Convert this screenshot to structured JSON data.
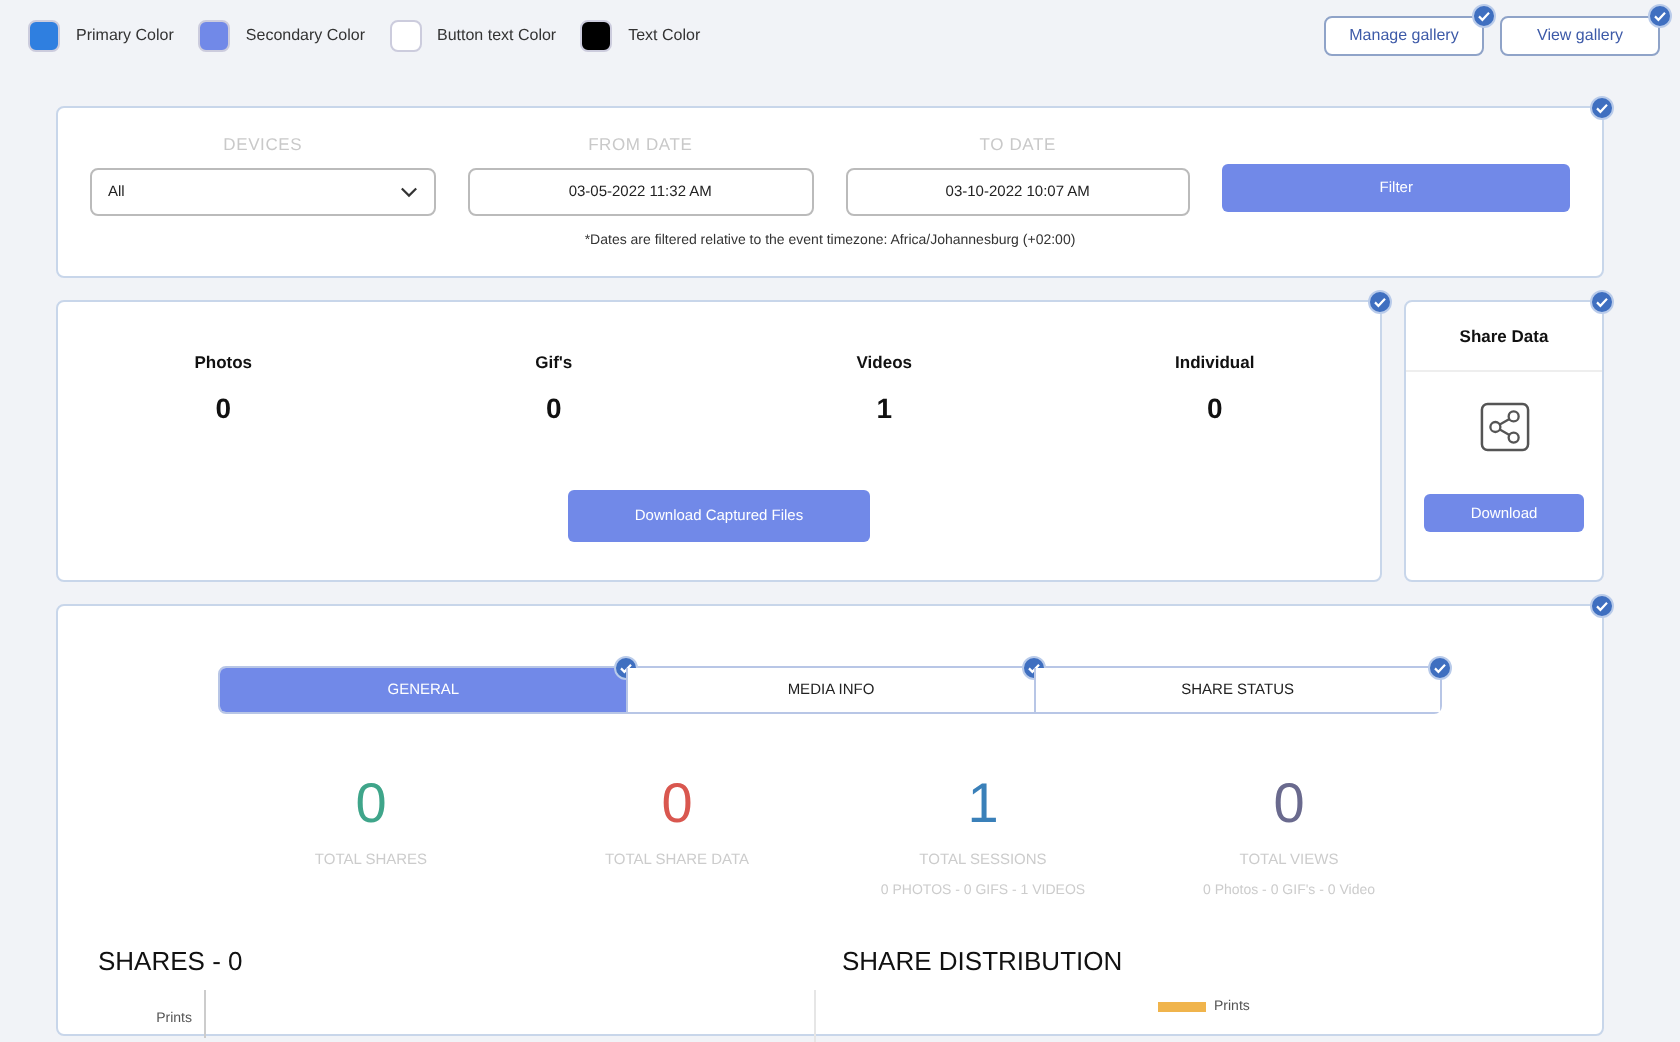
{
  "colors": [
    {
      "label": "Primary Color",
      "color": "#2f7fe0"
    },
    {
      "label": "Secondary Color",
      "color": "#7189e8"
    },
    {
      "label": "Button text Color",
      "color": "#ffffff"
    },
    {
      "label": "Text Color",
      "color": "#000000"
    }
  ],
  "gallery_buttons": [
    "Manage gallery",
    "View gallery"
  ],
  "filter": {
    "fields": [
      {
        "label": "DEVICES",
        "kind": "select",
        "value": "All"
      },
      {
        "label": "FROM DATE",
        "kind": "date",
        "value": "03-05-2022 11:32 AM"
      },
      {
        "label": "TO DATE",
        "kind": "date",
        "value": "03-10-2022 10:07 AM"
      }
    ],
    "button": "Filter",
    "note": "*Dates are filtered relative to the event timezone: Africa/Johannesburg (+02:00)"
  },
  "captured": {
    "stats": [
      {
        "label": "Photos",
        "value": "0"
      },
      {
        "label": "Gif's",
        "value": "0"
      },
      {
        "label": "Videos",
        "value": "1"
      },
      {
        "label": "Individual",
        "value": "0"
      }
    ],
    "button": "Download Captured Files"
  },
  "share_data": {
    "title": "Share Data",
    "button": "Download"
  },
  "tabs": [
    {
      "label": "GENERAL",
      "selected": true
    },
    {
      "label": "MEDIA INFO",
      "selected": false
    },
    {
      "label": "SHARE STATUS",
      "selected": false
    }
  ],
  "totals": [
    {
      "value": "0",
      "label": "TOTAL SHARES",
      "color": "#3fa58a"
    },
    {
      "value": "0",
      "label": "TOTAL SHARE DATA",
      "color": "#d9574f"
    },
    {
      "value": "1",
      "label": "TOTAL SESSIONS",
      "detail": "0 PHOTOS - 0 GIFS - 1 VIDEOS",
      "color": "#3a80b9"
    },
    {
      "value": "0",
      "label": "TOTAL VIEWS",
      "detail": "0 Photos - 0 GIF's - 0 Video",
      "color": "#6a6a8e"
    }
  ],
  "shares": {
    "title": "SHARES - 0",
    "axis_label": "Prints"
  },
  "distribution": {
    "title": "SHARE DISTRIBUTION",
    "legend": [
      {
        "label": "Prints",
        "color": "#f0b44c"
      }
    ]
  }
}
